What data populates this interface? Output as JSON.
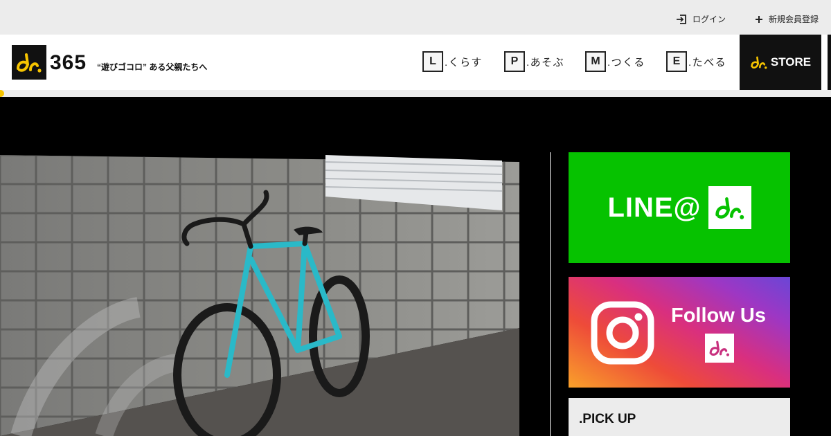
{
  "topbar": {
    "login_label": "ログイン",
    "register_label": "新規会員登録"
  },
  "header": {
    "logo_number": "365",
    "tagline": "“遊びゴコロ” ある父親たちへ",
    "nav": [
      {
        "letter": "L",
        "label": ".くらす"
      },
      {
        "letter": "P",
        "label": ".あそぶ"
      },
      {
        "letter": "M",
        "label": ".つくる"
      },
      {
        "letter": "E",
        "label": ".たべる"
      }
    ],
    "store_label": "STORE"
  },
  "progress": {
    "value": 0.005
  },
  "sidebar": {
    "line_text": "LINE@",
    "follow_text": "Follow Us",
    "pickup_title": ".PICK UP"
  },
  "colors": {
    "brand_yellow": "#f6c400",
    "line_green": "#06c200",
    "dark": "#111111"
  },
  "icons": {
    "login": "login-arrow-icon",
    "register": "plus-icon",
    "instagram": "instagram-icon"
  }
}
